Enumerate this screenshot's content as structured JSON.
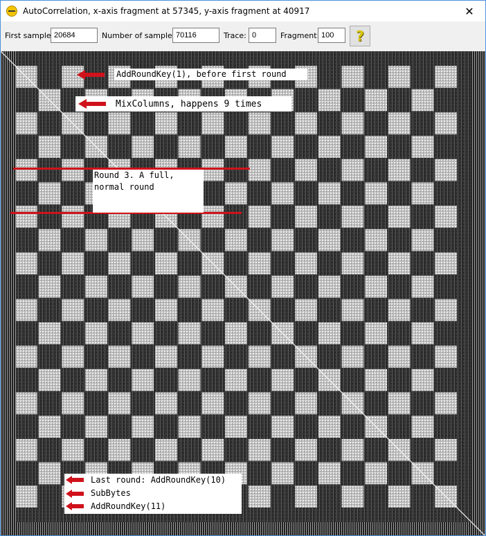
{
  "window": {
    "title": "AutoCorrelation, x-axis fragment at 57345, y-axis fragment at 40917",
    "close_glyph": "✕",
    "app_icon": "oscilloscope-icon"
  },
  "toolbar": {
    "first_sample_label": "First sample:",
    "first_sample_value": "20684",
    "num_samples_label": "Number of samples:",
    "num_samples_value": "70116",
    "trace_label": "Trace:",
    "trace_value": "0",
    "fragment_label": "Fragment:",
    "fragment_value": "100",
    "help_glyph": "?"
  },
  "annotations": {
    "add_round_key_1": "AddRoundKey(1), before first round",
    "mix_columns": "MixColumns, happens 9 times",
    "round3": "Round 3. A full,\nnormal round",
    "last_round": "Last round: AddRoundKey(10)",
    "sub_bytes": "SubBytes",
    "add_round_key_11": "AddRoundKey(11)"
  },
  "colors": {
    "annotation_red": "#d0121b",
    "plot_dark": "#1e1e1e",
    "plot_light": "#cfcfcf"
  }
}
